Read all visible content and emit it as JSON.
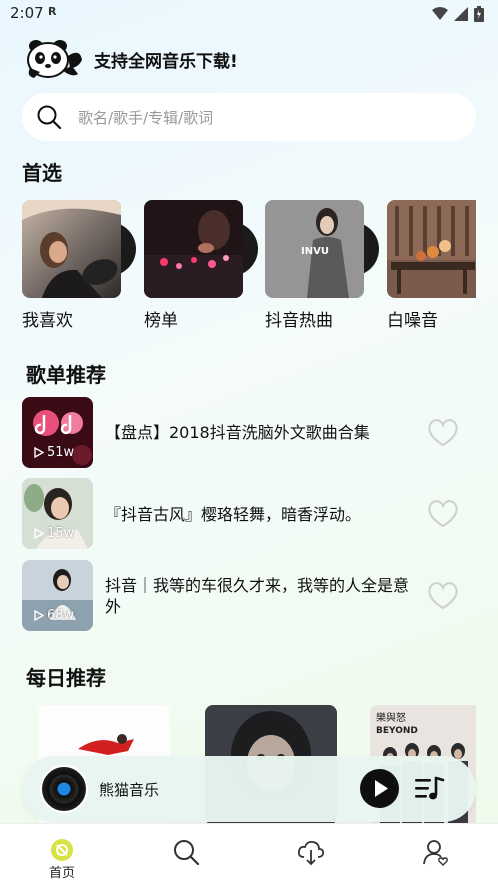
{
  "status": {
    "time": "2:07",
    "indicator": "R"
  },
  "brand": {
    "title": "支持全网音乐下载!"
  },
  "search": {
    "placeholder": "歌名/歌手/专辑/歌词"
  },
  "sections": {
    "featured_title": "首选",
    "playlist_title": "歌单推荐",
    "daily_title": "每日推荐"
  },
  "featured": [
    {
      "label": "我喜欢",
      "icon": "car-driver-photo"
    },
    {
      "label": "榜单",
      "icon": "dj-mixer-photo"
    },
    {
      "label": "抖音热曲",
      "icon": "invu-woman-photo"
    },
    {
      "label": "白噪音",
      "icon": "bench-toys-photo"
    }
  ],
  "playlists": [
    {
      "title": "【盘点】2018抖音洗脑外文歌曲合集",
      "plays": "51w"
    },
    {
      "title": "『抖音古风』樱珞轻舞，暗香浮动。",
      "plays": "15w"
    },
    {
      "title": "抖音｜我等的车很久才来，我等的人全是意外",
      "plays": "68w"
    }
  ],
  "daily": [
    {
      "name": "dance-album"
    },
    {
      "name": "portrait-album"
    },
    {
      "name": "beyond-album",
      "text_top": "樂與怒",
      "text_bottom": "BEYOND"
    }
  ],
  "player": {
    "title": "熊猫音乐"
  },
  "tabs": [
    {
      "label": "首页",
      "icon": "home-icon",
      "active": true
    },
    {
      "label": "",
      "icon": "search-icon"
    },
    {
      "label": "",
      "icon": "download-icon"
    },
    {
      "label": "",
      "icon": "profile-icon"
    }
  ],
  "colors": {
    "accent": "#d7e342",
    "heart_stroke": "#cfcfcf",
    "tab_bg": "#ffffff"
  }
}
